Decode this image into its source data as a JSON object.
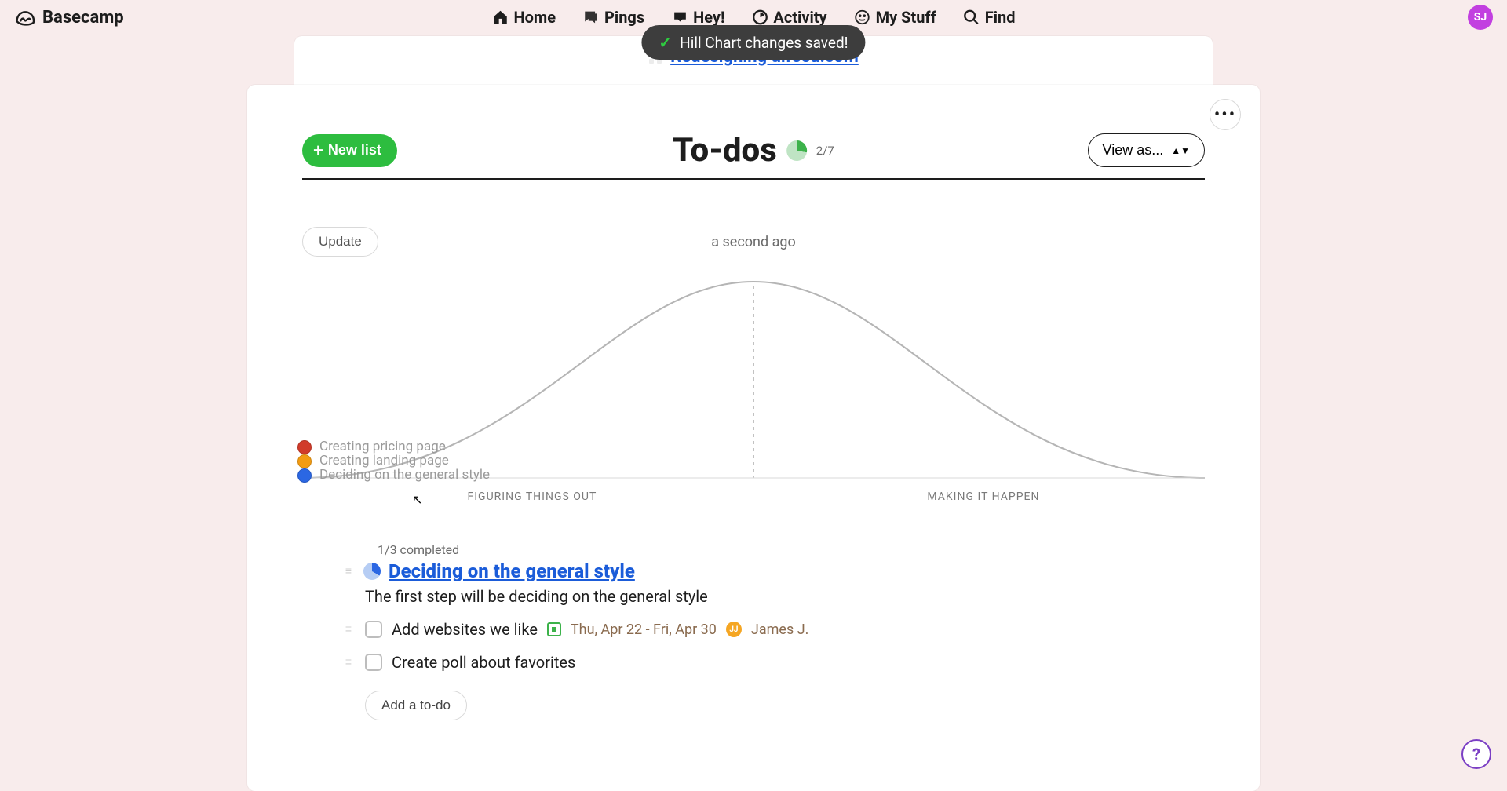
{
  "brand": "Basecamp",
  "avatar_initials": "SJ",
  "nav": {
    "home": "Home",
    "pings": "Pings",
    "hey": "Hey!",
    "activity": "Activity",
    "mystuff": "My Stuff",
    "find": "Find"
  },
  "toast": {
    "icon": "✓",
    "message": "Hill Chart changes saved!"
  },
  "breadcrumb": {
    "project": "Redesigning uifeed.com"
  },
  "todos": {
    "title": "To-dos",
    "count": "2/7",
    "new_list_btn": "New list",
    "view_as_btn": "View as...",
    "update_btn": "Update",
    "timestamp": "a second ago",
    "hill": {
      "left_label": "FIGURING THINGS OUT",
      "right_label": "MAKING IT HAPPEN",
      "dots": [
        {
          "label": "Creating pricing page",
          "color": "#d13b2a"
        },
        {
          "label": "Creating landing page",
          "color": "#f39c12"
        },
        {
          "label": "Deciding on the general style",
          "color": "#2b67e3"
        }
      ]
    },
    "list": {
      "completed": "1/3 completed",
      "title": "Deciding on the general style",
      "desc": "The first step will be deciding on the general style",
      "items": [
        {
          "text": "Add websites we like",
          "date": "Thu, Apr 22 - Fri, Apr 30",
          "assignee_initials": "JJ",
          "assignee_name": "James J."
        },
        {
          "text": "Create poll about favorites"
        }
      ],
      "add_btn": "Add a to-do"
    }
  },
  "help_label": "?"
}
